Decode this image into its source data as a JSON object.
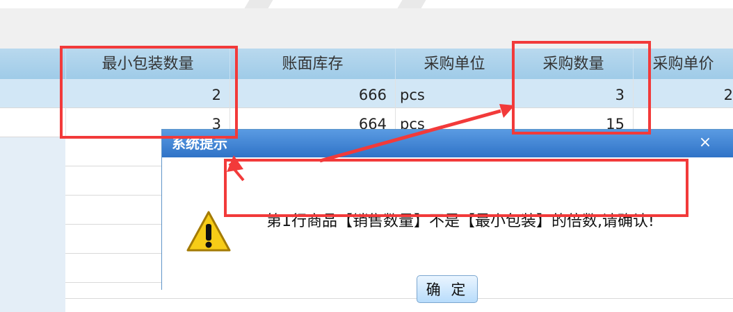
{
  "table": {
    "headers": [
      "最小包装数量",
      "账面库存",
      "采购单位",
      "采购数量",
      "采购单价"
    ],
    "rows": [
      {
        "min_pack": "2",
        "book_stock": "666",
        "unit": "pcs",
        "qty": "3",
        "price": "2"
      },
      {
        "min_pack": "3",
        "book_stock": "664",
        "unit": "pcs",
        "qty": "15",
        "price": ""
      }
    ]
  },
  "dialog": {
    "title": "系统提示",
    "close_glyph": "×",
    "message": "第1行商品【销售数量】不是【最小包装】的倍数,请确认!",
    "ok_label": "确 定",
    "icon": "warning-icon"
  },
  "colors": {
    "annotation_red": "#f23a3a",
    "header_blue": "#a9d1ec",
    "dialog_title_blue": "#3f84d4"
  }
}
